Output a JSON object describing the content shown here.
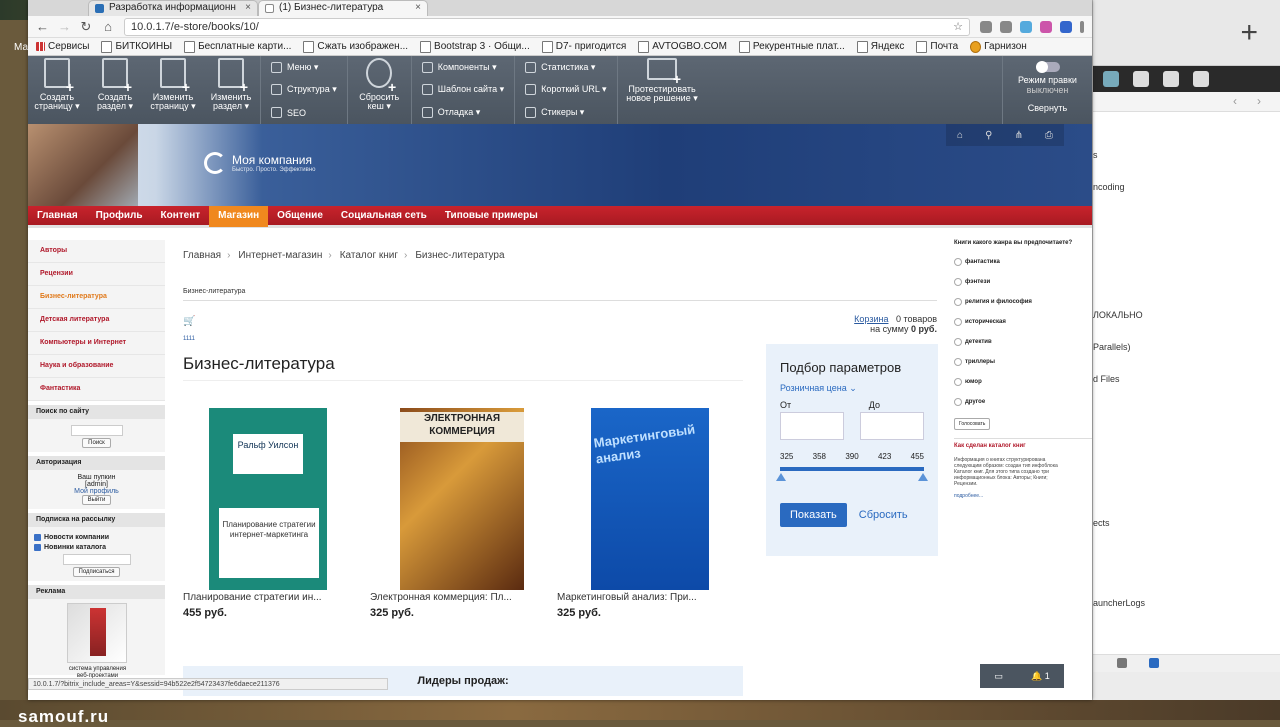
{
  "mac": {
    "menu_partial": "Ма"
  },
  "browser": {
    "tabs": [
      {
        "label": "Разработка информационн"
      },
      {
        "label": "(1) Бизнес-литература"
      }
    ],
    "url": "10.0.1.7/e-store/books/10/",
    "bookmarks": [
      "Сервисы",
      "БИТКОИНЫ",
      "Бесплатные карти...",
      "Сжать изображен...",
      "Bootstrap 3 · Общи...",
      "D7- пригодится",
      "AVTOGBO.COM",
      "Рекурентные плат...",
      "Яндекс",
      "Почта",
      "Гарнизон"
    ],
    "status_url": "10.0.1.7/?bitrix_include_areas=Y&sessid=94b522e2f54723437fe6daece211376"
  },
  "admin_panel": {
    "buttons": [
      {
        "line1": "Создать",
        "line2": "страницу ▾"
      },
      {
        "line1": "Создать",
        "line2": "раздел ▾"
      },
      {
        "line1": "Изменить",
        "line2": "страницу ▾"
      },
      {
        "line1": "Изменить",
        "line2": "раздел ▾"
      }
    ],
    "col1": [
      "Меню ▾",
      "Структура ▾",
      "SEO"
    ],
    "cache": {
      "line1": "Сбросить",
      "line2": "кеш ▾"
    },
    "col2": [
      "Компоненты ▾",
      "Шаблон сайта ▾",
      "Отладка ▾"
    ],
    "col3": [
      "Статистика ▾",
      "Короткий URL ▾",
      "Стикеры ▾"
    ],
    "test": {
      "line1": "Протестировать",
      "line2": "новое решение ▾"
    },
    "edit_mode": {
      "label": "Режим правки",
      "state": "выключен",
      "collapse": "Свернуть"
    }
  },
  "site": {
    "logo_name": "Моя компания",
    "logo_slogan": "Быстро. Просто. Эффективно",
    "nav": [
      "Главная",
      "Профиль",
      "Контент",
      "Магазин",
      "Общение",
      "Социальная сеть",
      "Типовые примеры"
    ],
    "nav_active": 3
  },
  "left_sidebar": {
    "items": [
      "Авторы",
      "Рецензии",
      "Бизнес-литература",
      "Детская литература",
      "Компьютеры и Интернет",
      "Наука и образование",
      "Фантастика"
    ],
    "active": 2,
    "search": {
      "title": "Поиск по сайту",
      "button": "Поиск"
    },
    "auth": {
      "title": "Авторизация",
      "greeting": "Ваш пупкин",
      "login": "[admin]",
      "profile": "Мой профиль",
      "logout": "Выйти"
    },
    "subscribe": {
      "title": "Подписка на рассылку",
      "opt1": "Новости компании",
      "opt2": "Новинки каталога",
      "button": "Подписаться"
    },
    "ad": {
      "title": "Реклама",
      "caption": "система управления веб-проектами"
    }
  },
  "main": {
    "breadcrumbs": [
      "Главная",
      "Интернет-магазин",
      "Каталог книг",
      "Бизнес-литература"
    ],
    "category_label": "Бизнес-литература",
    "cart": {
      "link": "Корзина",
      "count": "0 товаров",
      "sum_label": "на сумму",
      "sum": "0 руб."
    },
    "small_text": "1111",
    "title": "Бизнес-литература",
    "products": [
      {
        "name": "Планирование стратегии ин...",
        "price": "455 руб.",
        "cover_top": "Ральф Уилсон",
        "cover_bottom": "Планирование стратегии интернет-маркетинга"
      },
      {
        "name": "Электронная коммерция: Пл...",
        "price": "325 руб.",
        "cover_top": "ЭЛЕКТРОННАЯ КОММЕРЦИЯ"
      },
      {
        "name": "Маркетинговый анализ: При...",
        "price": "325 руб.",
        "cover_top": "Маркетинговый анализ"
      }
    ],
    "leaders": "Лидеры продаж:"
  },
  "filter": {
    "title": "Подбор параметров",
    "section": "Розничная цена ⌄",
    "from": "От",
    "to": "До",
    "ticks": [
      "325",
      "358",
      "390",
      "423",
      "455"
    ],
    "show": "Показать",
    "reset": "Сбросить"
  },
  "poll": {
    "question": "Книги какого жанра вы предпочитаете?",
    "options": [
      "фантастика",
      "фэнтези",
      "религия и философия",
      "историческая",
      "детектив",
      "триллеры",
      "юмор",
      "другое"
    ],
    "vote": "Голосовать",
    "how_title": "Как сделан каталог книг",
    "how_text": "Информация о книгах структурирована следующим образом: создан тип инфоблока Каталог книг. Для этого типа создано три информационных блока: Авторы; Книги; Рецензии.",
    "more": "подробнее..."
  },
  "widget": {
    "notifications": "1"
  },
  "right_window": {
    "items": [
      "s",
      "ncoding",
      "ЛОКАЛЬНО",
      "Parallels)",
      "d Files",
      "ects",
      "auncherLogs"
    ]
  },
  "watermark": "samouf.ru"
}
